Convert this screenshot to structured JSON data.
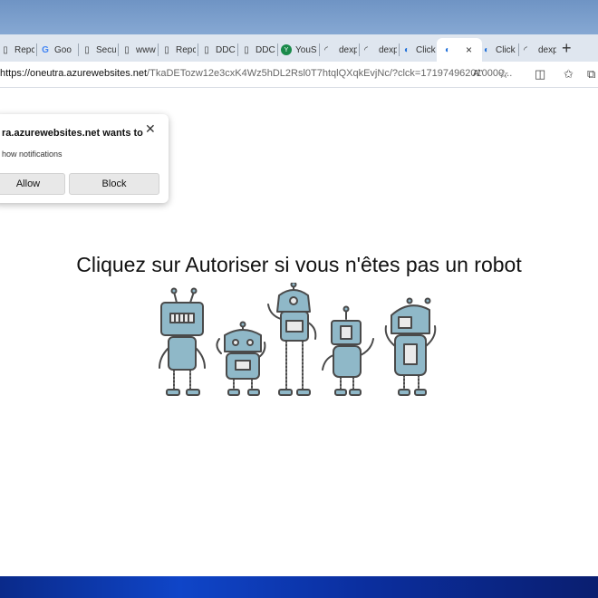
{
  "browser": {
    "tabs": [
      {
        "label": "Repc",
        "icon": "page-icon"
      },
      {
        "label": "Goo",
        "icon": "google-icon"
      },
      {
        "label": "Secu",
        "icon": "page-icon"
      },
      {
        "label": "www",
        "icon": "page-icon"
      },
      {
        "label": "Repc",
        "icon": "page-icon"
      },
      {
        "label": "DDC",
        "icon": "page-icon"
      },
      {
        "label": "DDC",
        "icon": "page-icon"
      },
      {
        "label": "YouS",
        "icon": "site-icon"
      },
      {
        "label": "dexp",
        "icon": "loading-icon"
      },
      {
        "label": "dexp",
        "icon": "loading-icon"
      },
      {
        "label": "Click",
        "icon": "edge-icon"
      },
      {
        "label": "",
        "icon": "edge-icon",
        "active": true
      },
      {
        "label": "Click",
        "icon": "edge-icon"
      },
      {
        "label": "dexp",
        "icon": "loading-icon"
      }
    ],
    "new_tab": "+",
    "close_glyph": "×",
    "url": {
      "host": "https://oneutra.azurewebsites.net",
      "path": "/TkaDETozw12e3cxK4Wz5hDL2Rsl0T7htqlQXqkEvjNc/?clck=171974962010000..."
    },
    "read_aloud_label": "A”"
  },
  "popup": {
    "title": "ra.azurewebsites.net wants to",
    "description": "how notifications",
    "allow": "Allow",
    "block": "Block",
    "close_glyph": "✕"
  },
  "page": {
    "headline": "Cliquez sur Autoriser si vous n'êtes pas un robot"
  },
  "colors": {
    "robot_fill": "#8fb8c8",
    "robot_line": "#4a4a4a",
    "accent_edge": "#1e6fd9"
  }
}
